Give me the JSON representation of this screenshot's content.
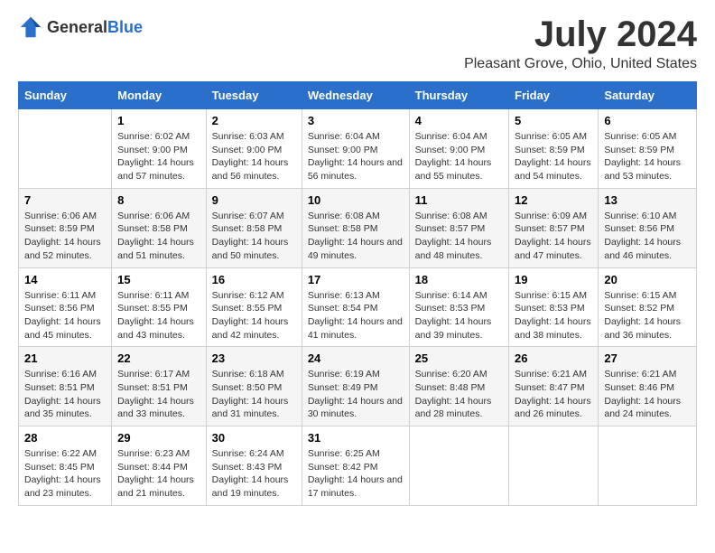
{
  "logo": {
    "general": "General",
    "blue": "Blue"
  },
  "title": "July 2024",
  "subtitle": "Pleasant Grove, Ohio, United States",
  "days_of_week": [
    "Sunday",
    "Monday",
    "Tuesday",
    "Wednesday",
    "Thursday",
    "Friday",
    "Saturday"
  ],
  "weeks": [
    [
      {
        "num": "",
        "sunrise": "",
        "sunset": "",
        "daylight": ""
      },
      {
        "num": "1",
        "sunrise": "Sunrise: 6:02 AM",
        "sunset": "Sunset: 9:00 PM",
        "daylight": "Daylight: 14 hours and 57 minutes."
      },
      {
        "num": "2",
        "sunrise": "Sunrise: 6:03 AM",
        "sunset": "Sunset: 9:00 PM",
        "daylight": "Daylight: 14 hours and 56 minutes."
      },
      {
        "num": "3",
        "sunrise": "Sunrise: 6:04 AM",
        "sunset": "Sunset: 9:00 PM",
        "daylight": "Daylight: 14 hours and 56 minutes."
      },
      {
        "num": "4",
        "sunrise": "Sunrise: 6:04 AM",
        "sunset": "Sunset: 9:00 PM",
        "daylight": "Daylight: 14 hours and 55 minutes."
      },
      {
        "num": "5",
        "sunrise": "Sunrise: 6:05 AM",
        "sunset": "Sunset: 8:59 PM",
        "daylight": "Daylight: 14 hours and 54 minutes."
      },
      {
        "num": "6",
        "sunrise": "Sunrise: 6:05 AM",
        "sunset": "Sunset: 8:59 PM",
        "daylight": "Daylight: 14 hours and 53 minutes."
      }
    ],
    [
      {
        "num": "7",
        "sunrise": "Sunrise: 6:06 AM",
        "sunset": "Sunset: 8:59 PM",
        "daylight": "Daylight: 14 hours and 52 minutes."
      },
      {
        "num": "8",
        "sunrise": "Sunrise: 6:06 AM",
        "sunset": "Sunset: 8:58 PM",
        "daylight": "Daylight: 14 hours and 51 minutes."
      },
      {
        "num": "9",
        "sunrise": "Sunrise: 6:07 AM",
        "sunset": "Sunset: 8:58 PM",
        "daylight": "Daylight: 14 hours and 50 minutes."
      },
      {
        "num": "10",
        "sunrise": "Sunrise: 6:08 AM",
        "sunset": "Sunset: 8:58 PM",
        "daylight": "Daylight: 14 hours and 49 minutes."
      },
      {
        "num": "11",
        "sunrise": "Sunrise: 6:08 AM",
        "sunset": "Sunset: 8:57 PM",
        "daylight": "Daylight: 14 hours and 48 minutes."
      },
      {
        "num": "12",
        "sunrise": "Sunrise: 6:09 AM",
        "sunset": "Sunset: 8:57 PM",
        "daylight": "Daylight: 14 hours and 47 minutes."
      },
      {
        "num": "13",
        "sunrise": "Sunrise: 6:10 AM",
        "sunset": "Sunset: 8:56 PM",
        "daylight": "Daylight: 14 hours and 46 minutes."
      }
    ],
    [
      {
        "num": "14",
        "sunrise": "Sunrise: 6:11 AM",
        "sunset": "Sunset: 8:56 PM",
        "daylight": "Daylight: 14 hours and 45 minutes."
      },
      {
        "num": "15",
        "sunrise": "Sunrise: 6:11 AM",
        "sunset": "Sunset: 8:55 PM",
        "daylight": "Daylight: 14 hours and 43 minutes."
      },
      {
        "num": "16",
        "sunrise": "Sunrise: 6:12 AM",
        "sunset": "Sunset: 8:55 PM",
        "daylight": "Daylight: 14 hours and 42 minutes."
      },
      {
        "num": "17",
        "sunrise": "Sunrise: 6:13 AM",
        "sunset": "Sunset: 8:54 PM",
        "daylight": "Daylight: 14 hours and 41 minutes."
      },
      {
        "num": "18",
        "sunrise": "Sunrise: 6:14 AM",
        "sunset": "Sunset: 8:53 PM",
        "daylight": "Daylight: 14 hours and 39 minutes."
      },
      {
        "num": "19",
        "sunrise": "Sunrise: 6:15 AM",
        "sunset": "Sunset: 8:53 PM",
        "daylight": "Daylight: 14 hours and 38 minutes."
      },
      {
        "num": "20",
        "sunrise": "Sunrise: 6:15 AM",
        "sunset": "Sunset: 8:52 PM",
        "daylight": "Daylight: 14 hours and 36 minutes."
      }
    ],
    [
      {
        "num": "21",
        "sunrise": "Sunrise: 6:16 AM",
        "sunset": "Sunset: 8:51 PM",
        "daylight": "Daylight: 14 hours and 35 minutes."
      },
      {
        "num": "22",
        "sunrise": "Sunrise: 6:17 AM",
        "sunset": "Sunset: 8:51 PM",
        "daylight": "Daylight: 14 hours and 33 minutes."
      },
      {
        "num": "23",
        "sunrise": "Sunrise: 6:18 AM",
        "sunset": "Sunset: 8:50 PM",
        "daylight": "Daylight: 14 hours and 31 minutes."
      },
      {
        "num": "24",
        "sunrise": "Sunrise: 6:19 AM",
        "sunset": "Sunset: 8:49 PM",
        "daylight": "Daylight: 14 hours and 30 minutes."
      },
      {
        "num": "25",
        "sunrise": "Sunrise: 6:20 AM",
        "sunset": "Sunset: 8:48 PM",
        "daylight": "Daylight: 14 hours and 28 minutes."
      },
      {
        "num": "26",
        "sunrise": "Sunrise: 6:21 AM",
        "sunset": "Sunset: 8:47 PM",
        "daylight": "Daylight: 14 hours and 26 minutes."
      },
      {
        "num": "27",
        "sunrise": "Sunrise: 6:21 AM",
        "sunset": "Sunset: 8:46 PM",
        "daylight": "Daylight: 14 hours and 24 minutes."
      }
    ],
    [
      {
        "num": "28",
        "sunrise": "Sunrise: 6:22 AM",
        "sunset": "Sunset: 8:45 PM",
        "daylight": "Daylight: 14 hours and 23 minutes."
      },
      {
        "num": "29",
        "sunrise": "Sunrise: 6:23 AM",
        "sunset": "Sunset: 8:44 PM",
        "daylight": "Daylight: 14 hours and 21 minutes."
      },
      {
        "num": "30",
        "sunrise": "Sunrise: 6:24 AM",
        "sunset": "Sunset: 8:43 PM",
        "daylight": "Daylight: 14 hours and 19 minutes."
      },
      {
        "num": "31",
        "sunrise": "Sunrise: 6:25 AM",
        "sunset": "Sunset: 8:42 PM",
        "daylight": "Daylight: 14 hours and 17 minutes."
      },
      {
        "num": "",
        "sunrise": "",
        "sunset": "",
        "daylight": ""
      },
      {
        "num": "",
        "sunrise": "",
        "sunset": "",
        "daylight": ""
      },
      {
        "num": "",
        "sunrise": "",
        "sunset": "",
        "daylight": ""
      }
    ]
  ]
}
